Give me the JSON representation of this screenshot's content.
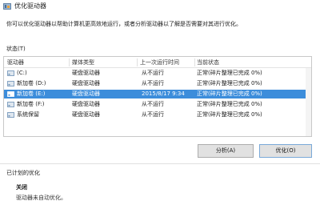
{
  "window": {
    "title": "优化驱动器"
  },
  "description": "你可以优化驱动器以帮助计算机更高效地运行，或者分析驱动器以了解是否需要对其进行优化。",
  "status_label": "状态(T)",
  "drive_list": {
    "columns": [
      "驱动器",
      "媒体类型",
      "上一次运行时间",
      "当前状态"
    ],
    "rows": [
      {
        "drive": "(C:)",
        "media": "硬盘驱动器",
        "last_run": "从不运行",
        "status": "正常(碎片整理已完成 0%)",
        "selected": false
      },
      {
        "drive": "新加卷 (D:)",
        "media": "硬盘驱动器",
        "last_run": "从不运行",
        "status": "正常(碎片整理已完成 0%)",
        "selected": false
      },
      {
        "drive": "新加卷 (E:)",
        "media": "硬盘驱动器",
        "last_run": "2015/8/17 9:34",
        "status": "正常(碎片整理已完成 0%)",
        "selected": true
      },
      {
        "drive": "新加卷 (F:)",
        "media": "硬盘驱动器",
        "last_run": "从不运行",
        "status": "正常(碎片整理已完成 0%)",
        "selected": false
      },
      {
        "drive": "系统保留",
        "media": "硬盘驱动器",
        "last_run": "从不运行",
        "status": "正常(碎片整理已完成 0%)",
        "selected": false
      }
    ]
  },
  "buttons": {
    "analyze": "分析(A)",
    "optimize": "优化(O)"
  },
  "scheduled": {
    "label": "已计划的优化",
    "status": "关闭",
    "description": "驱动器未自动优化。"
  },
  "colors": {
    "selection": "#3c8ddb",
    "drive_icon": "#6a8fb5"
  },
  "icons": {
    "app": "defrag-icon",
    "drive": "drive-icon"
  }
}
